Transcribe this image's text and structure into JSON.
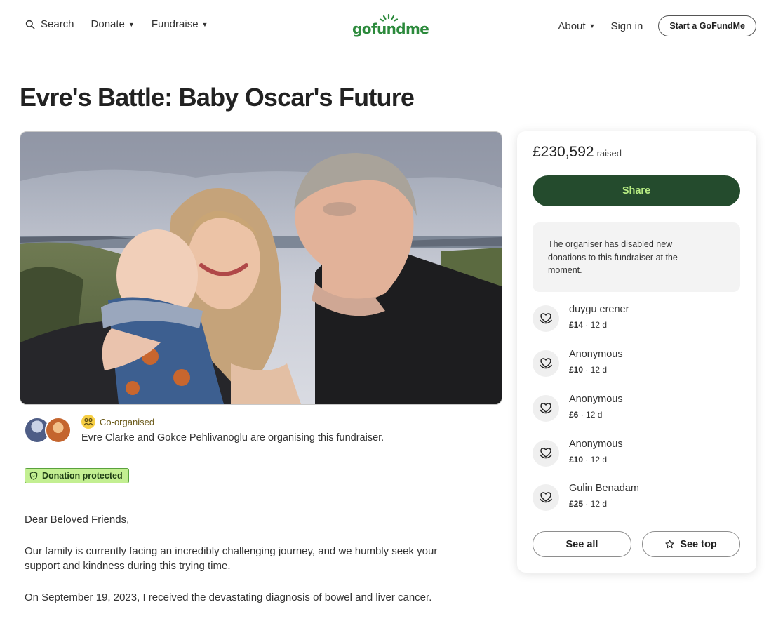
{
  "header": {
    "search_label": "Search",
    "donate_label": "Donate",
    "fundraise_label": "Fundraise",
    "logo_text": "gofundme",
    "about_label": "About",
    "sign_in_label": "Sign in",
    "start_label": "Start a GoFundMe"
  },
  "page": {
    "title": "Evre's Battle: Baby Oscar's Future"
  },
  "organiser": {
    "badge_label": "Co-organised",
    "text": "Evre Clarke and Gokce Pehlivanoglu are organising this fundraiser."
  },
  "protection": {
    "label": "Donation protected"
  },
  "story": {
    "paragraphs": [
      "Dear Beloved Friends,",
      "Our family is currently facing an incredibly challenging journey, and we humbly seek your support and kindness during this trying time.",
      "On September 19, 2023, I received the devastating diagnosis of bowel and liver cancer."
    ]
  },
  "sidebar": {
    "raised_amount": "£230,592",
    "raised_label": "raised",
    "share_label": "Share",
    "notice": "The organiser has disabled new donations to this fundraiser at the moment.",
    "donations": [
      {
        "name": "duygu erener",
        "amount": "£14",
        "time": "12 d"
      },
      {
        "name": "Anonymous",
        "amount": "£10",
        "time": "12 d"
      },
      {
        "name": "Anonymous",
        "amount": "£6",
        "time": "12 d"
      },
      {
        "name": "Anonymous",
        "amount": "£10",
        "time": "12 d"
      },
      {
        "name": "Gulin Benadam",
        "amount": "£25",
        "time": "12 d"
      }
    ],
    "separator": " · ",
    "see_all_label": "See all",
    "see_top_label": "See top"
  },
  "colors": {
    "brand_green": "#2c8a3c",
    "share_bg": "#244b2d",
    "share_text": "#b8ed83",
    "protected_bg": "#c3ef92"
  }
}
